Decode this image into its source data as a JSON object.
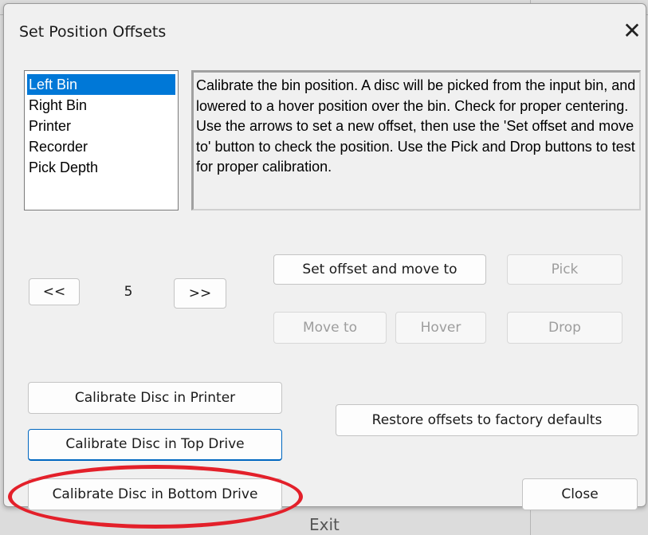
{
  "dialog": {
    "title": "Set Position Offsets",
    "close_glyph": "✕"
  },
  "list": {
    "items": [
      "Left Bin",
      "Right Bin",
      "Printer",
      "Recorder",
      "Pick Depth"
    ],
    "selected": "Left Bin"
  },
  "description": "Calibrate the bin position. A disc will be picked from the input bin, and lowered to a hover position over the bin. Check for proper centering. Use the arrows to set a new offset, then use the 'Set offset and move to' button to check the position. Use the Pick and Drop buttons to test for proper calibration.",
  "stepper": {
    "decrement_label": "<<",
    "value": "5",
    "increment_label": ">>"
  },
  "actions": {
    "set_offset_label": "Set offset and move to",
    "pick_label": "Pick",
    "move_to_label": "Move to",
    "hover_label": "Hover",
    "drop_label": "Drop"
  },
  "calibrate": {
    "printer_label": "Calibrate Disc in Printer",
    "top_drive_label": "Calibrate Disc in Top Drive",
    "bottom_drive_label": "Calibrate Disc in Bottom Drive"
  },
  "restore_label": "Restore offsets to factory defaults",
  "close_label": "Close",
  "background": {
    "partial_text": "Exit"
  },
  "colors": {
    "selection": "#0078d7",
    "annotation": "#e3202a",
    "focus": "#0067c0"
  }
}
